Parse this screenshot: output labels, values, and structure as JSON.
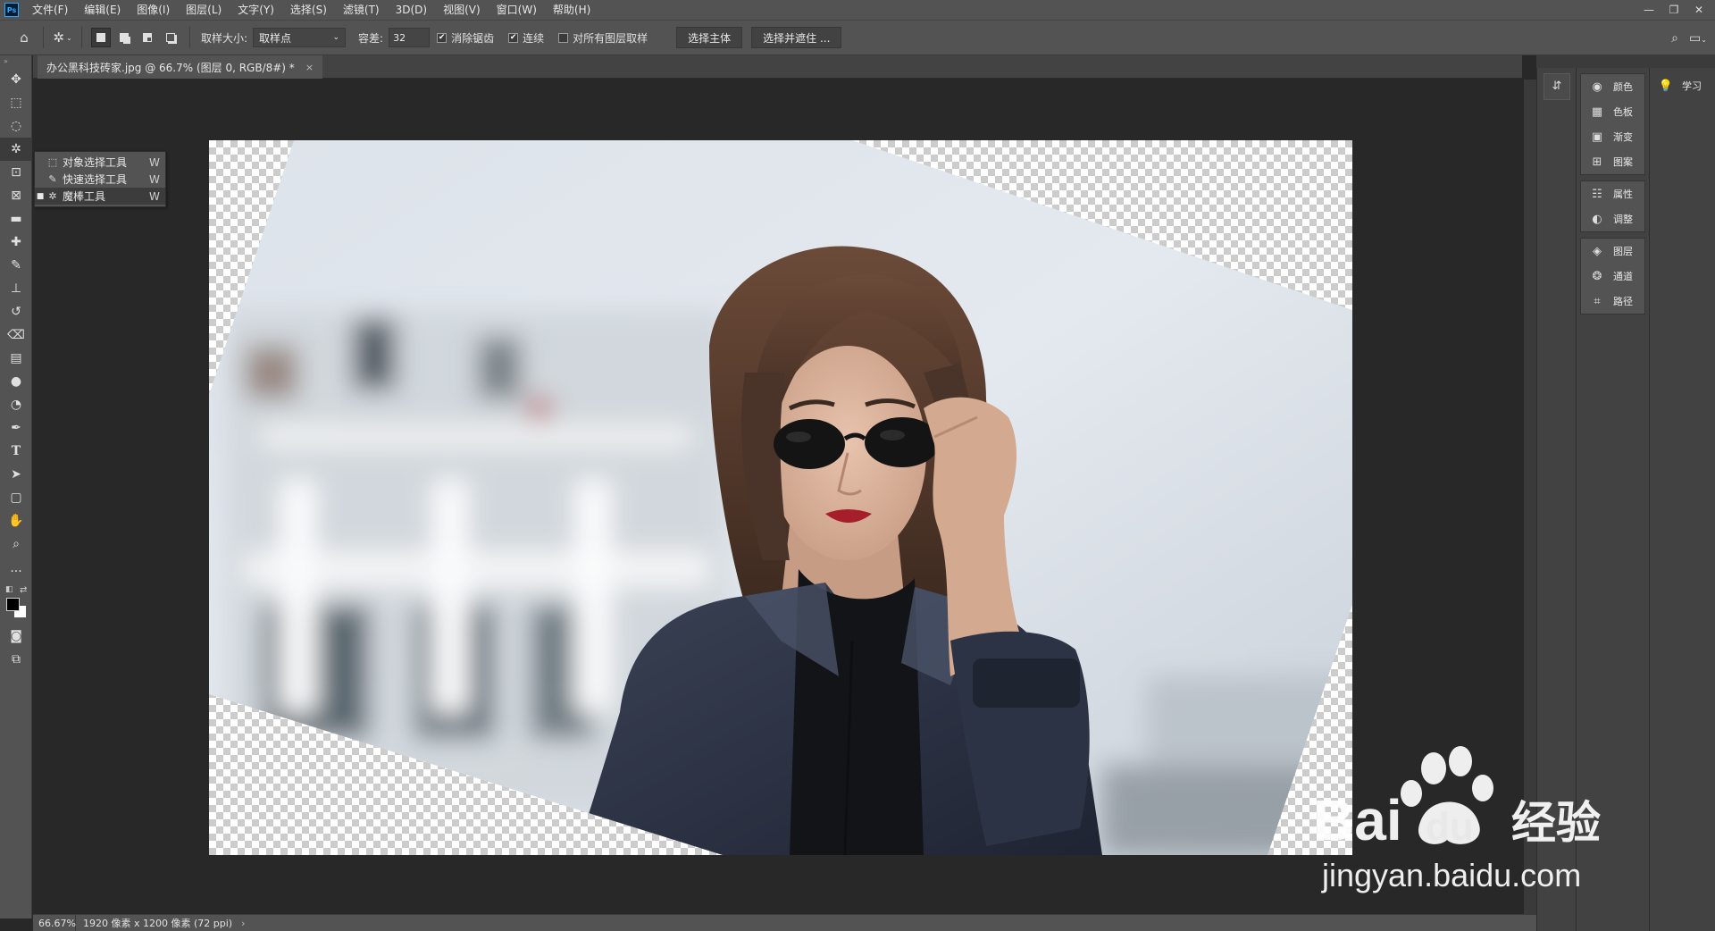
{
  "menubar": {
    "app_logo": "Ps",
    "items": [
      "文件(F)",
      "编辑(E)",
      "图像(I)",
      "图层(L)",
      "文字(Y)",
      "选择(S)",
      "滤镜(T)",
      "3D(D)",
      "视图(V)",
      "窗口(W)",
      "帮助(H)"
    ]
  },
  "options": {
    "sample_size_label": "取样大小:",
    "sample_size_value": "取样点",
    "tolerance_label": "容差:",
    "tolerance_value": "32",
    "antialias_label": "消除锯齿",
    "antialias_checked": true,
    "contiguous_label": "连续",
    "contiguous_checked": true,
    "all_layers_label": "对所有图层取样",
    "all_layers_checked": false,
    "select_subject_label": "选择主体",
    "select_mask_label": "选择并遮住 ..."
  },
  "flyout": {
    "items": [
      {
        "label": "对象选择工具",
        "key": "W",
        "selected": false
      },
      {
        "label": "快速选择工具",
        "key": "W",
        "selected": false
      },
      {
        "label": "魔棒工具",
        "key": "W",
        "selected": true
      }
    ]
  },
  "document": {
    "tab_title": "办公黑科技砖家.jpg @ 66.7% (图层 0, RGB/8#) *",
    "close_glyph": "×"
  },
  "panels": {
    "group1": [
      {
        "icon": "color-icon",
        "label": "颜色"
      },
      {
        "icon": "swatches-icon",
        "label": "色板"
      },
      {
        "icon": "gradient-icon",
        "label": "渐变"
      },
      {
        "icon": "patterns-icon",
        "label": "图案"
      }
    ],
    "group2": [
      {
        "icon": "properties-icon",
        "label": "属性"
      },
      {
        "icon": "adjustments-icon",
        "label": "调整"
      }
    ],
    "group3": [
      {
        "icon": "layers-icon",
        "label": "图层"
      },
      {
        "icon": "channels-icon",
        "label": "通道"
      },
      {
        "icon": "paths-icon",
        "label": "路径"
      }
    ],
    "learn_label": "学习"
  },
  "status": {
    "zoom": "66.67%",
    "doc_info": "1920 像素 x 1200 像素 (72 ppi)"
  },
  "watermark": {
    "brand_latin": "Bai",
    "brand_du": "du",
    "brand_cn": "经验",
    "url": "jingyan.baidu.com"
  },
  "colors": {
    "ui_bg": "#535353",
    "workspace": "#282828",
    "accent": "#31a8ff"
  }
}
